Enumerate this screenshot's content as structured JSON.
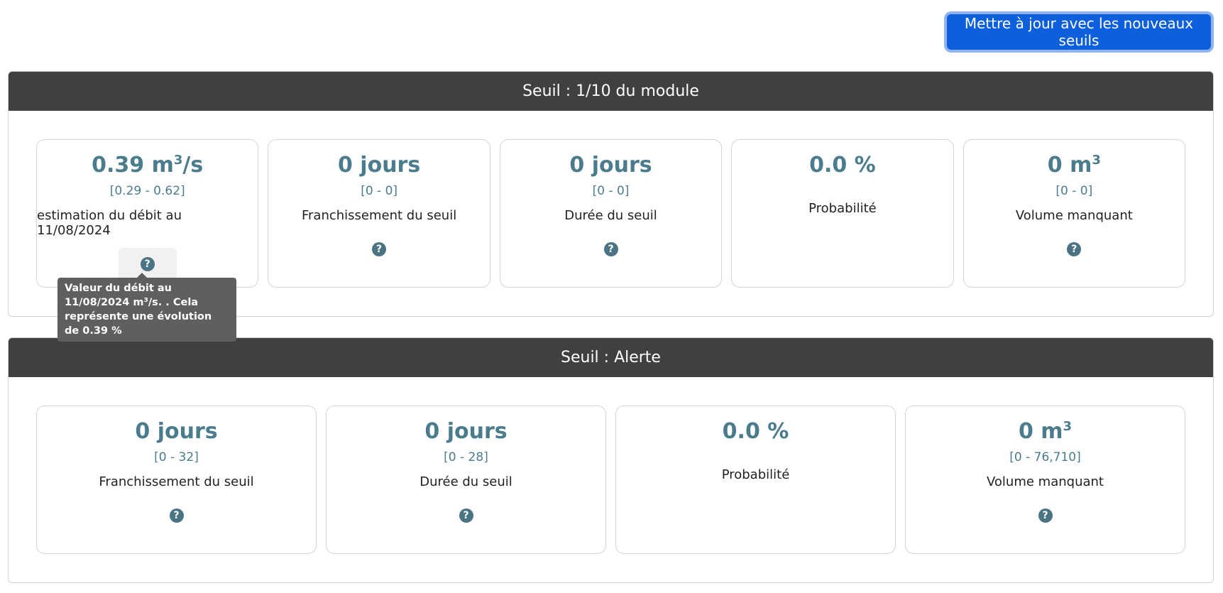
{
  "toolbar": {
    "update_label": "Mettre à jour avec les nouveaux seuils"
  },
  "sections": [
    {
      "title": "Seuil : 1/10 du module",
      "cards": [
        {
          "value": "0.39 m",
          "sup": "3",
          "suffix": "/s",
          "range": "[0.29 - 0.62]",
          "label": "estimation du débit au 11/08/2024"
        },
        {
          "value": "0 jours",
          "range": "[0 - 0]",
          "label": "Franchissement du seuil"
        },
        {
          "value": "0 jours",
          "range": "[0 - 0]",
          "label": "Durée du seuil"
        },
        {
          "value": "0.0 %",
          "label": "Probabilité"
        },
        {
          "value": "0 m",
          "sup": "3",
          "range": "[0 - 0]",
          "label": "Volume manquant"
        }
      ]
    },
    {
      "title": "Seuil : Alerte",
      "cards": [
        {
          "value": "0 jours",
          "range": "[0 - 32]",
          "label": "Franchissement du seuil"
        },
        {
          "value": "0 jours",
          "range": "[0 - 28]",
          "label": "Durée du seuil"
        },
        {
          "value": "0.0 %",
          "label": "Probabilité"
        },
        {
          "value": "0 m",
          "sup": "3",
          "range": "[0 - 76,710]",
          "label": "Volume manquant"
        }
      ]
    }
  ],
  "tooltip": {
    "text": "Valeur du débit au 11/08/2024 m³/s. . Cela représente une évolution de 0.39 %"
  },
  "help_icon_glyph": "?",
  "colors": {
    "accent": "#4a7c8e",
    "header": "#404041",
    "button": "#0d5fdc"
  }
}
